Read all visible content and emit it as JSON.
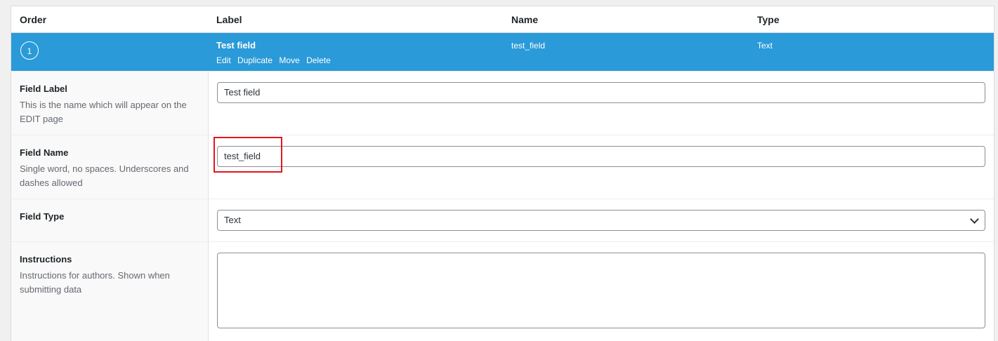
{
  "table_header": {
    "order": "Order",
    "label": "Label",
    "name": "Name",
    "type": "Type"
  },
  "field": {
    "order": "1",
    "label": "Test field",
    "name": "test_field",
    "type": "Text",
    "actions": [
      "Edit",
      "Duplicate",
      "Move",
      "Delete"
    ]
  },
  "settings": {
    "field_label": {
      "title": "Field Label",
      "description": "This is the name which will appear on the EDIT page",
      "value": "Test field"
    },
    "field_name": {
      "title": "Field Name",
      "description": "Single word, no spaces. Underscores and dashes allowed",
      "value": "test_field"
    },
    "field_type": {
      "title": "Field Type",
      "selected": "Text"
    },
    "instructions": {
      "title": "Instructions",
      "description": "Instructions for authors. Shown when submitting data",
      "value": ""
    }
  },
  "colors": {
    "row_highlight": "#2a9ad8",
    "annotation_box": "#e3161d"
  }
}
